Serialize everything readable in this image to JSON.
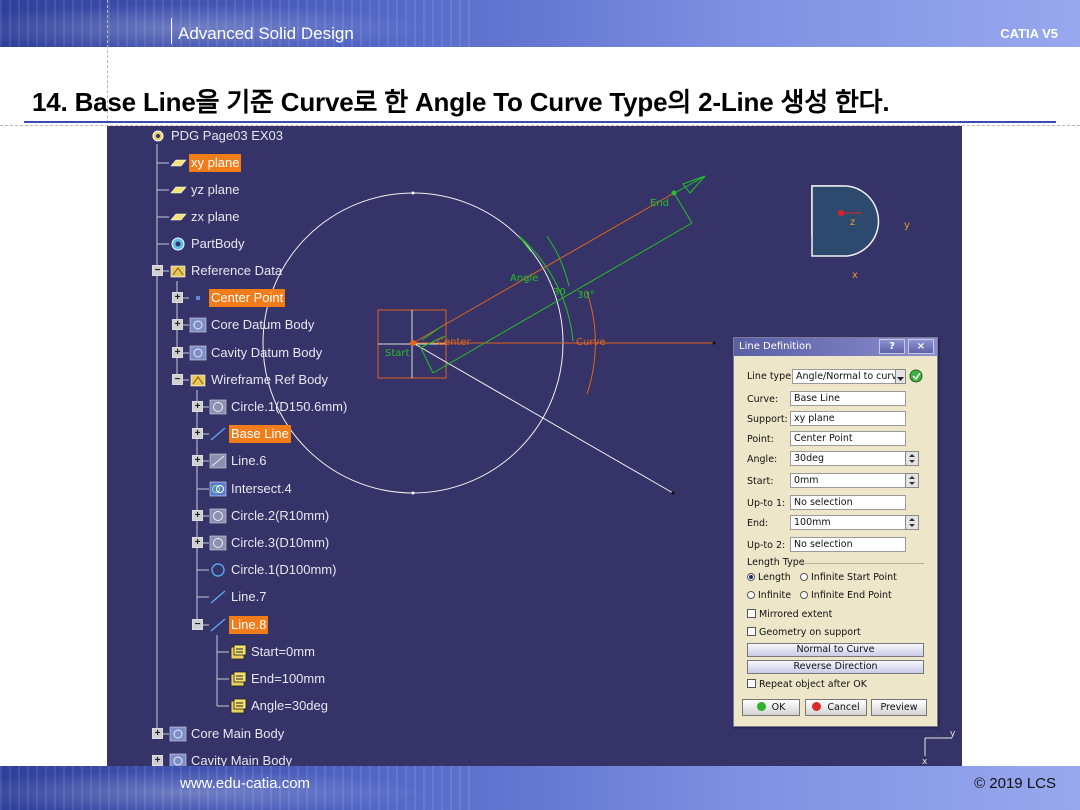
{
  "header": {
    "course": "Advanced Solid Design",
    "brand": "CATIA V5"
  },
  "title": "14. Base Line을 기준 Curve로 한 Angle To Curve Type의 2-Line 생성 한다.",
  "footer": {
    "site": "www.edu-catia.com",
    "copyright": "© 2019 LCS"
  },
  "tree": {
    "root": "PDG Page03 EX03",
    "nodes": [
      {
        "label": "xy plane",
        "icon": "plane-icon",
        "selected": true
      },
      {
        "label": "yz plane",
        "icon": "plane-icon",
        "selected": false
      },
      {
        "label": "zx plane",
        "icon": "plane-icon",
        "selected": false
      },
      {
        "label": "PartBody",
        "icon": "gear-icon",
        "selected": false
      },
      {
        "label": "Reference Data",
        "icon": "hybrid-body-icon",
        "selected": false
      },
      {
        "label": "Center Point",
        "icon": "point-icon",
        "selected": true
      },
      {
        "label": "Core Datum Body",
        "icon": "body-icon",
        "selected": false
      },
      {
        "label": "Cavity Datum Body",
        "icon": "body-icon",
        "selected": false
      },
      {
        "label": "Wireframe Ref Body",
        "icon": "hybrid-body-icon",
        "selected": false
      },
      {
        "label": "Circle.1(D150.6mm)",
        "icon": "circle-feature-icon",
        "selected": false
      },
      {
        "label": "Base Line",
        "icon": "line-icon",
        "selected": true
      },
      {
        "label": "Line.6",
        "icon": "line-feature-icon",
        "selected": false
      },
      {
        "label": "Intersect.4",
        "icon": "intersect-icon",
        "selected": false
      },
      {
        "label": "Circle.2(R10mm)",
        "icon": "circle-feature-icon",
        "selected": false
      },
      {
        "label": "Circle.3(D10mm)",
        "icon": "circle-feature-icon",
        "selected": false
      },
      {
        "label": "Circle.1(D100mm)",
        "icon": "circle-icon",
        "selected": false
      },
      {
        "label": "Line.7",
        "icon": "line-icon",
        "selected": false
      },
      {
        "label": "Line.8",
        "icon": "line-icon",
        "selected": true
      },
      {
        "label": "Start=0mm",
        "icon": "parameter-icon",
        "selected": false
      },
      {
        "label": "End=100mm",
        "icon": "parameter-icon",
        "selected": false
      },
      {
        "label": "Angle=30deg",
        "icon": "parameter-icon",
        "selected": false
      },
      {
        "label": "Core Main Body",
        "icon": "body-icon",
        "selected": false
      },
      {
        "label": "Cavity Main Body",
        "icon": "body-icon",
        "selected": false
      }
    ]
  },
  "viewport_labels": {
    "end": "End",
    "angle": "Angle",
    "angle_30": "30",
    "angle_30deg": "30°",
    "start": "Start",
    "center": "Center",
    "curve": "Curve"
  },
  "compass": {
    "z": "z",
    "y": "y",
    "x": "x"
  },
  "axis_mini": {
    "y": "y",
    "x": "x"
  },
  "dialog": {
    "title": "Line Definition",
    "help_button": "?",
    "close_button": "×",
    "line_type_label": "Line type :",
    "line_type_value": "Angle/Normal to curve",
    "curve_label": "Curve:",
    "curve_value": "Base Line",
    "support_label": "Support:",
    "support_value": "xy plane",
    "point_label": "Point:",
    "point_value": "Center Point",
    "angle_label": "Angle:",
    "angle_value": "30deg",
    "start_label": "Start:",
    "start_value": "0mm",
    "upto1_label": "Up-to 1:",
    "upto1_value": "No selection",
    "end_label": "End:",
    "end_value": "100mm",
    "upto2_label": "Up-to 2:",
    "upto2_value": "No selection",
    "length_type_title": "Length Type",
    "opt_length": "Length",
    "opt_infinite_start": "Infinite Start Point",
    "opt_infinite": "Infinite",
    "opt_infinite_end": "Infinite End Point",
    "mirrored_extent": "Mirrored extent",
    "geometry_on_support": "Geometry on support",
    "normal_to_curve": "Normal to Curve",
    "reverse_direction": "Reverse Direction",
    "repeat_object": "Repeat object after OK",
    "ok": "OK",
    "cancel": "Cancel",
    "preview": "Preview"
  },
  "colors": {
    "viewport_bg": "#353367",
    "selection": "#f07c1a",
    "construction": "#25c025",
    "result_line": "#e0661c",
    "dialog_bg": "#eee6c9"
  }
}
